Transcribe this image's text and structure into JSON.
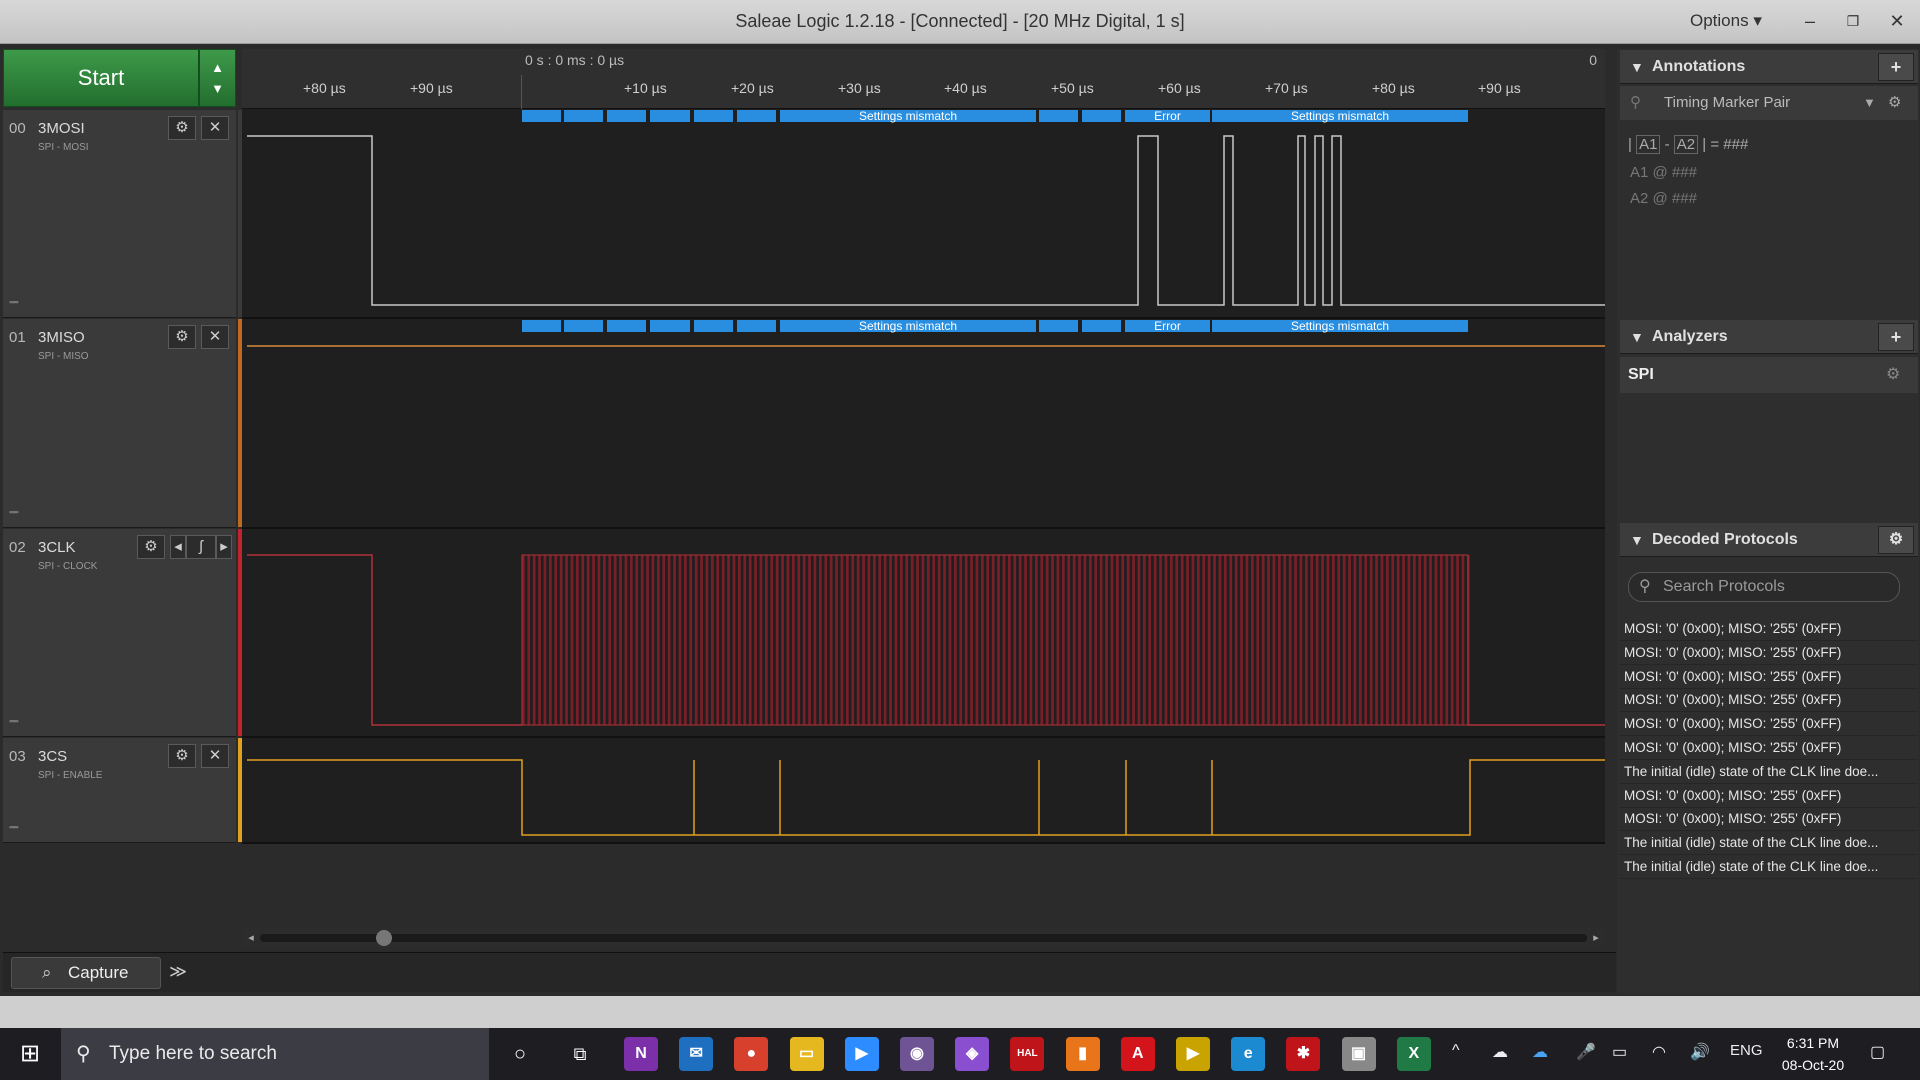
{
  "window": {
    "title": "Saleae Logic 1.2.18 - [Connected] - [20 MHz Digital, 1 s]",
    "options_label": "Options",
    "minimize": "–",
    "restore": "❐",
    "close": "✕"
  },
  "toolbar": {
    "start_label": "Start"
  },
  "ruler": {
    "top_label": "0 s : 0 ms : 0 µs",
    "zero_label": "0",
    "ticks": [
      "+80 µs",
      "+90 µs",
      "+10 µs",
      "+20 µs",
      "+30 µs",
      "+40 µs",
      "+50 µs",
      "+60 µs",
      "+70 µs",
      "+80 µs",
      "+90 µs"
    ]
  },
  "channels": [
    {
      "num": "00",
      "name": "3MOSI",
      "sub": "SPI - MOSI",
      "color": "#c8c8c8"
    },
    {
      "num": "01",
      "name": "3MISO",
      "sub": "SPI - MISO",
      "color": "#d98a3a"
    },
    {
      "num": "02",
      "name": "3CLK",
      "sub": "SPI - CLOCK",
      "color": "#b0303a"
    },
    {
      "num": "03",
      "name": "3CS",
      "sub": "SPI - ENABLE",
      "color": "#e0a020"
    }
  ],
  "bubbles": {
    "settings_mismatch": "Settings mismatch",
    "error": "Error"
  },
  "bottom": {
    "capture_label": "Capture",
    "more_label": "≫"
  },
  "annotations": {
    "header": "Annotations",
    "marker_pair": "Timing Marker Pair",
    "a1": "A1",
    "a2": "A2",
    "formula": "= ###",
    "a1_row": "A1  @  ###",
    "a2_row": "A2  @  ###"
  },
  "analyzers": {
    "header": "Analyzers",
    "items": [
      "SPI"
    ]
  },
  "decoded": {
    "header": "Decoded Protocols",
    "search_placeholder": "Search Protocols",
    "rows": [
      "MOSI: '0' (0x00);  MISO: '255' (0xFF)",
      "MOSI: '0' (0x00);  MISO: '255' (0xFF)",
      "MOSI: '0' (0x00);  MISO: '255' (0xFF)",
      "MOSI: '0' (0x00);  MISO: '255' (0xFF)",
      "MOSI: '0' (0x00);  MISO: '255' (0xFF)",
      "MOSI: '0' (0x00);  MISO: '255' (0xFF)",
      "The initial (idle) state of the CLK line doe...",
      "MOSI: '0' (0x00);  MISO: '255' (0xFF)",
      "MOSI: '0' (0x00);  MISO: '255' (0xFF)",
      "The initial (idle) state of the CLK line doe...",
      "The initial (idle) state of the CLK line doe..."
    ]
  },
  "taskbar": {
    "search_placeholder": "Type here to search",
    "language": "ENG",
    "time": "6:31 PM",
    "date": "08-Oct-20",
    "apps": [
      {
        "name": "onenote",
        "glyph": "N",
        "color": "#7b2fa8"
      },
      {
        "name": "mail",
        "glyph": "✉",
        "color": "#1e6fbf"
      },
      {
        "name": "chrome",
        "glyph": "●",
        "color": "#d8402e"
      },
      {
        "name": "file-explorer",
        "glyph": "▭",
        "color": "#e6b820"
      },
      {
        "name": "zoom",
        "glyph": "▶",
        "color": "#2d8cff"
      },
      {
        "name": "github",
        "glyph": "◉",
        "color": "#6e5494"
      },
      {
        "name": "app-purple",
        "glyph": "◈",
        "color": "#8a4fd0"
      },
      {
        "name": "halcogen",
        "glyph": "HAL",
        "color": "#c0141b"
      },
      {
        "name": "app-orange",
        "glyph": "▮",
        "color": "#e8751a"
      },
      {
        "name": "acrobat",
        "glyph": "A",
        "color": "#d4141b"
      },
      {
        "name": "app-yellow",
        "glyph": "▶",
        "color": "#c9a400"
      },
      {
        "name": "edge",
        "glyph": "e",
        "color": "#1b8ad0"
      },
      {
        "name": "app-red",
        "glyph": "✱",
        "color": "#c0141b"
      },
      {
        "name": "app-gray",
        "glyph": "▣",
        "color": "#888888"
      },
      {
        "name": "excel",
        "glyph": "X",
        "color": "#1f7a45"
      }
    ]
  }
}
